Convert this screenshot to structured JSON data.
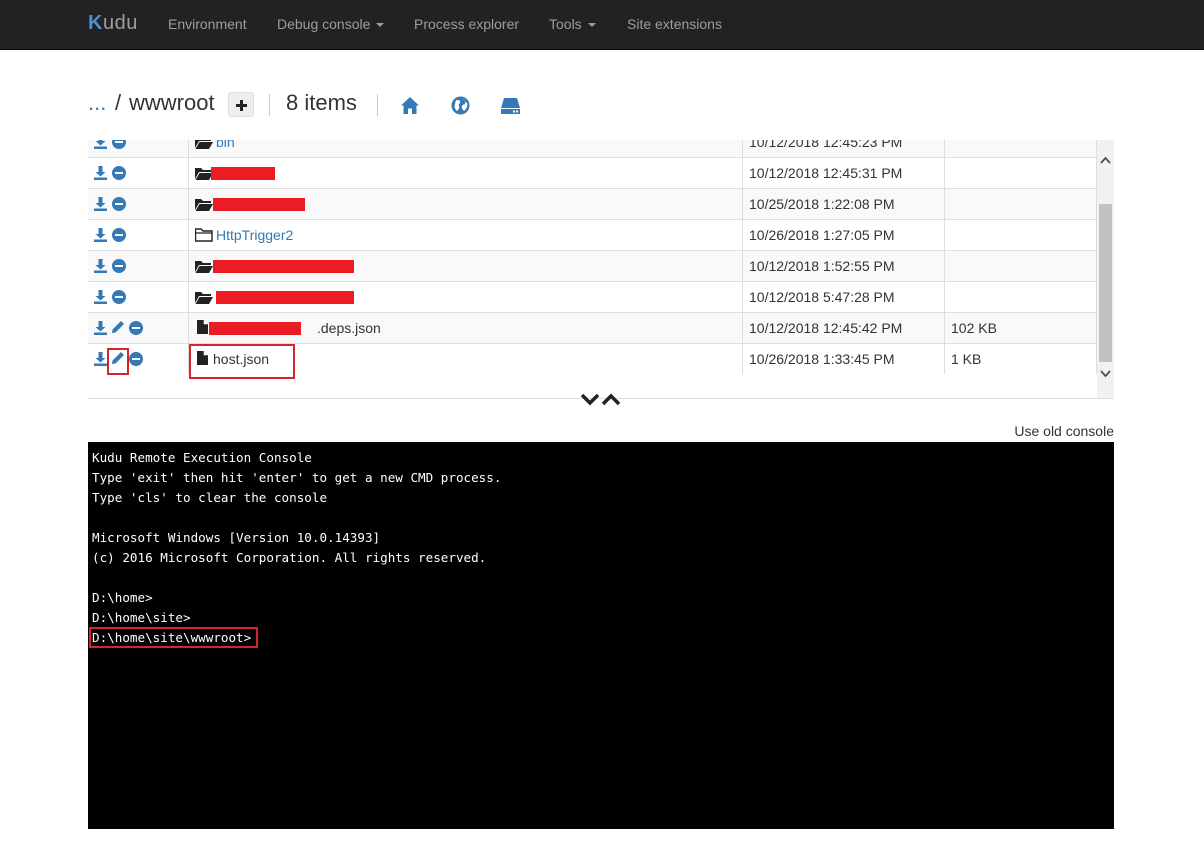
{
  "navbar": {
    "brand": "Kudu",
    "items": [
      {
        "label": "Environment",
        "dropdown": false
      },
      {
        "label": "Debug console",
        "dropdown": true
      },
      {
        "label": "Process explorer",
        "dropdown": false
      },
      {
        "label": "Tools",
        "dropdown": true
      },
      {
        "label": "Site extensions",
        "dropdown": false
      }
    ]
  },
  "breadcrumb": {
    "ellipsis": "...",
    "separator": "/",
    "current": "wwwroot",
    "item_count": "8 items",
    "icons": [
      "home-icon",
      "globe-icon",
      "drive-icon"
    ]
  },
  "files": [
    {
      "name": "bin",
      "type": "folder",
      "modified": "10/12/2018 12:45:23 PM",
      "size": ""
    },
    {
      "name": "",
      "type": "folder",
      "modified": "10/12/2018 12:45:31 PM",
      "size": ""
    },
    {
      "name": "",
      "type": "folder",
      "modified": "10/25/2018 1:22:08 PM",
      "size": ""
    },
    {
      "name": "HttpTrigger2",
      "type": "folder",
      "modified": "10/26/2018 1:27:05 PM",
      "size": ""
    },
    {
      "name": "",
      "type": "folder",
      "modified": "10/12/2018 1:52:55 PM",
      "size": ""
    },
    {
      "name": "",
      "type": "folder",
      "modified": "10/12/2018 5:47:28 PM",
      "size": ""
    },
    {
      "name": ".deps.json",
      "type": "file",
      "modified": "10/12/2018 12:45:42 PM",
      "size": "102 KB"
    },
    {
      "name": "host.json",
      "type": "file",
      "modified": "10/26/2018 1:33:45 PM",
      "size": "1 KB"
    }
  ],
  "console": {
    "old_console_link": "Use old console",
    "lines": "Kudu Remote Execution Console\nType 'exit' then hit 'enter' to get a new CMD process.\nType 'cls' to clear the console\n\nMicrosoft Windows [Version 10.0.14393]\n(c) 2016 Microsoft Corporation. All rights reserved.\n\nD:\\home>\nD:\\home\\site>\nD:\\home\\site\\wwwroot>"
  },
  "colors": {
    "navbar_bg": "#222222",
    "link": "#337ab7",
    "highlight": "#d9232a",
    "redaction": "#ec1c24",
    "console_bg": "#000000"
  }
}
